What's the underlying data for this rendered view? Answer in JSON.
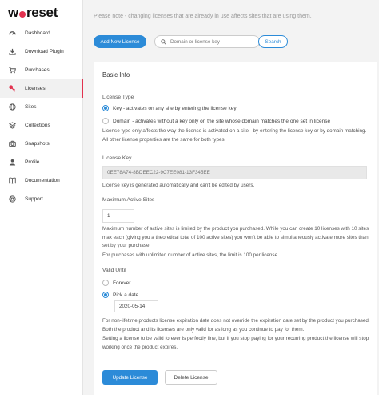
{
  "brand": {
    "logo_left": "w",
    "logo_right": "reset"
  },
  "sidebar": {
    "items": [
      {
        "label": "Dashboard",
        "icon": "gauge-icon"
      },
      {
        "label": "Download Plugin",
        "icon": "download-icon"
      },
      {
        "label": "Purchases",
        "icon": "cart-icon"
      },
      {
        "label": "Licenses",
        "icon": "key-icon",
        "active": true
      },
      {
        "label": "Sites",
        "icon": "globe-icon"
      },
      {
        "label": "Collections",
        "icon": "stack-icon"
      },
      {
        "label": "Snapshots",
        "icon": "camera-icon"
      },
      {
        "label": "Profile",
        "icon": "user-icon"
      },
      {
        "label": "Documentation",
        "icon": "book-icon"
      },
      {
        "label": "Support",
        "icon": "lifebuoy-icon"
      }
    ]
  },
  "notice": "Please note - changing licenses that are already in use affects sites that are using them.",
  "toolbar": {
    "add_label": "Add New License",
    "search_placeholder": "Domain or license key",
    "search_label": "Search"
  },
  "card": {
    "title": "Basic Info",
    "license_type": {
      "label": "License Type",
      "options": [
        {
          "text": "Key - activates on any site by entering the license key",
          "selected": true
        },
        {
          "text": "Domain - activates without a key only on the site whose domain matches the one set in license",
          "selected": false
        }
      ],
      "help": "License type only affects the way the license is activated on a site - by entering the license key or by domain matching. All other license properties are the same for both types."
    },
    "license_key": {
      "label": "License Key",
      "value": "0EE78A74-8BDEEC22-9C7EE081-13F345EE",
      "help": "License key is generated automatically and can't be edited by users."
    },
    "max_sites": {
      "label": "Maximum Active Sites",
      "value": "1",
      "help1": "Maximum number of active sites is limited by the product you purchased. While you can create 10 licenses with 10 sites max each (giving you a theoretical total of 100 active sites) you won't be able to simultaneously activate more sites than set by your purchase.",
      "help2": "For purchases with unlimited number of active sites, the limit is 100 per license."
    },
    "valid_until": {
      "label": "Valid Until",
      "options": [
        {
          "text": "Forever",
          "selected": false
        },
        {
          "text": "Pick a date",
          "selected": true
        }
      ],
      "date": "2020-05-14",
      "help1": "For non-lifetime products license expiration date does not override the expiration date set by the product you purchased. Both the product and its licenses are only valid for as long as you continue to pay for them.",
      "help2": "Setting a license to be valid forever is perfectly fine, but if you stop paying for your recurring product the license will stop working once the product expires."
    },
    "buttons": {
      "update": "Update License",
      "delete": "Delete License"
    }
  },
  "colors": {
    "accent": "#2c8bd8",
    "brand": "#e2324f"
  }
}
